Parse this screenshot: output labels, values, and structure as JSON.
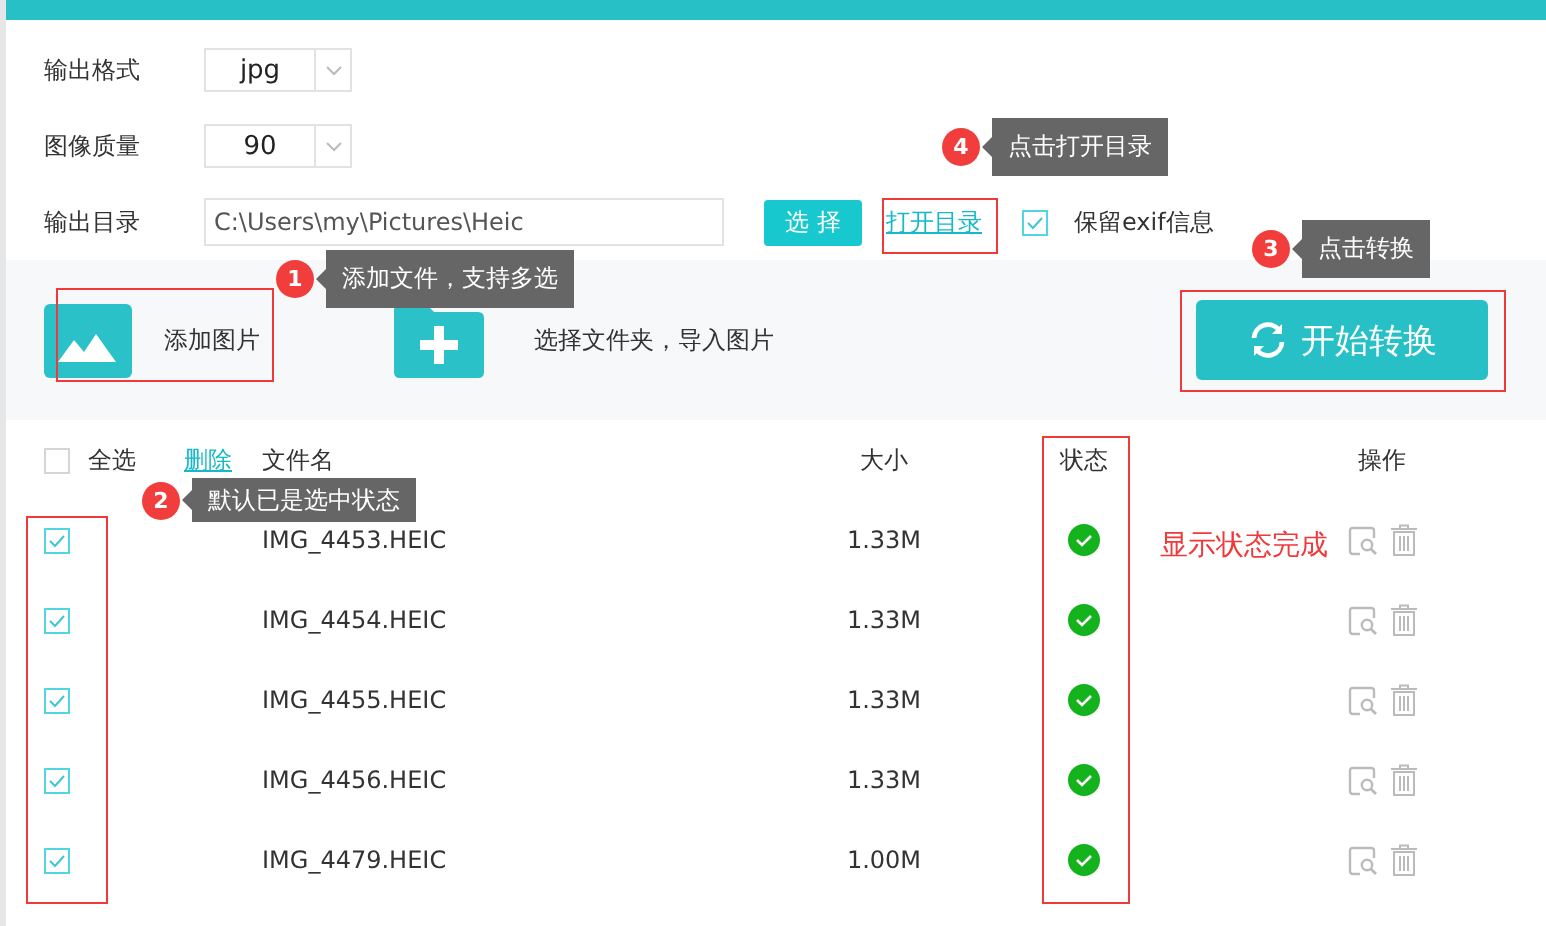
{
  "form": {
    "output_format": {
      "label": "输出格式",
      "value": "jpg"
    },
    "quality": {
      "label": "图像质量",
      "value": "90"
    },
    "output_dir": {
      "label": "输出目录",
      "value": "C:\\Users\\my\\Pictures\\Heic"
    },
    "browse_button": "选 择",
    "open_dir_link": "打开目录",
    "keep_exif": {
      "label": "保留exif信息",
      "checked": true
    }
  },
  "toolbar": {
    "add_image": "添加图片",
    "add_folder": "选择文件夹，导入图片",
    "start_button": "开始转换"
  },
  "table": {
    "select_all": {
      "label": "全选",
      "checked": false
    },
    "delete_link": "删除",
    "columns": [
      "文件名",
      "大小",
      "状态",
      "操作"
    ],
    "rows": [
      {
        "name": "IMG_4453.HEIC",
        "size": "1.33M",
        "checked": true,
        "completed": true
      },
      {
        "name": "IMG_4454.HEIC",
        "size": "1.33M",
        "checked": true,
        "completed": true
      },
      {
        "name": "IMG_4455.HEIC",
        "size": "1.33M",
        "checked": true,
        "completed": true
      },
      {
        "name": "IMG_4456.HEIC",
        "size": "1.33M",
        "checked": true,
        "completed": true
      },
      {
        "name": "IMG_4479.HEIC",
        "size": "1.00M",
        "checked": true,
        "completed": true
      }
    ]
  },
  "annotations": [
    {
      "number": "1",
      "text": "添加文件，支持多选"
    },
    {
      "number": "2",
      "text": "默认已是选中状态"
    },
    {
      "number": "3",
      "text": "点击转换"
    },
    {
      "number": "4",
      "text": "点击打开目录"
    }
  ],
  "status_note": "显示状态完成"
}
